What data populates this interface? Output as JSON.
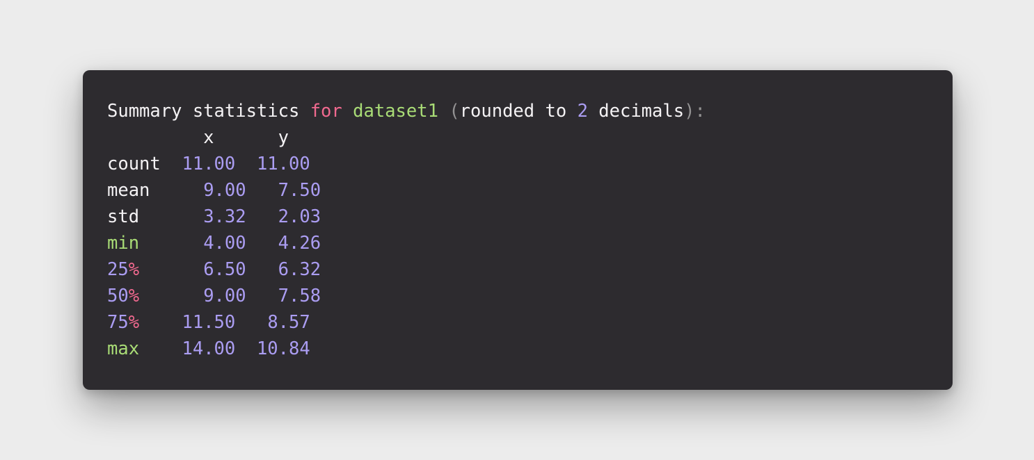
{
  "title_line": {
    "prefix": "Summary statistics ",
    "keyword": "for",
    "space1": " ",
    "dataset": "dataset1",
    "space2": " ",
    "open_paren": "(",
    "middle": "rounded to ",
    "digits": "2",
    "suffix": " decimals",
    "close": "):"
  },
  "header_row": "         x      y",
  "rows": [
    {
      "label": "count",
      "label_pad": "  ",
      "values": "11.00  11.00"
    },
    {
      "label": "mean",
      "label_pad": "     ",
      "values": "9.00   7.50"
    },
    {
      "label": "std",
      "label_pad": "      ",
      "values": "3.32   2.03"
    },
    {
      "label": "min",
      "label_pad": "      ",
      "values": "4.00   4.26"
    },
    {
      "label_num": "25",
      "label_pct": "%",
      "label_pad": "      ",
      "values": "6.50   6.32"
    },
    {
      "label_num": "50",
      "label_pct": "%",
      "label_pad": "      ",
      "values": "9.00   7.58"
    },
    {
      "label_num": "75",
      "label_pct": "%",
      "label_pad": "    ",
      "values": "11.50   8.57"
    },
    {
      "label": "max",
      "label_pad": "    ",
      "values": "14.00  10.84"
    }
  ],
  "colors": {
    "panel_background": "#2d2b2f",
    "page_background": "#ececec",
    "keyword": "#f0698f",
    "name": "#a9dc76",
    "number": "#ab9df2",
    "punctuation": "#939293",
    "text": "#f4f2f4"
  }
}
